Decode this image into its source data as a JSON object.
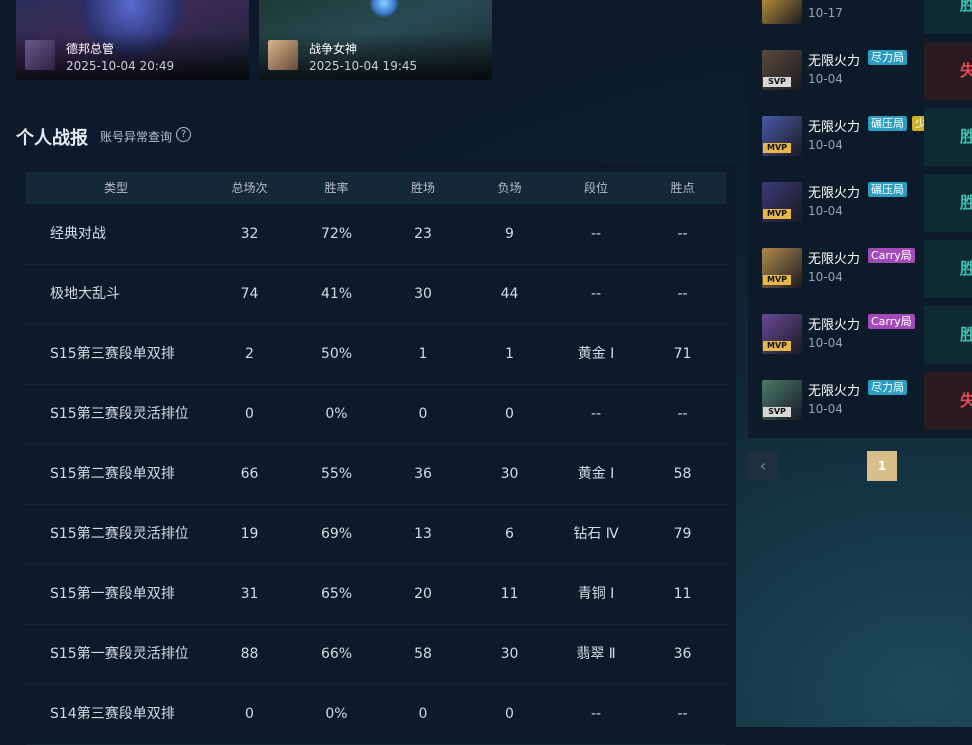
{
  "recent_games": [
    {
      "champion": "德邦总管",
      "time": "2025-10-04 20:49"
    },
    {
      "champion": "战争女神",
      "time": "2025-10-04 19:45"
    }
  ],
  "section": {
    "title": "个人战报",
    "link": "账号异常查询",
    "help": "?"
  },
  "table": {
    "headers": [
      "类型",
      "总场次",
      "胜率",
      "胜场",
      "负场",
      "段位",
      "胜点"
    ],
    "rows": [
      [
        "经典对战",
        "32",
        "72%",
        "23",
        "9",
        "--",
        "--"
      ],
      [
        "极地大乱斗",
        "74",
        "41%",
        "30",
        "44",
        "--",
        "--"
      ],
      [
        "S15第三赛段单双排",
        "2",
        "50%",
        "1",
        "1",
        "黄金 Ⅰ",
        "71"
      ],
      [
        "S15第三赛段灵活排位",
        "0",
        "0%",
        "0",
        "0",
        "--",
        "--"
      ],
      [
        "S15第二赛段单双排",
        "66",
        "55%",
        "36",
        "30",
        "黄金 Ⅰ",
        "58"
      ],
      [
        "S15第二赛段灵活排位",
        "19",
        "69%",
        "13",
        "6",
        "钻石 Ⅳ",
        "79"
      ],
      [
        "S15第一赛段单双排",
        "31",
        "65%",
        "20",
        "11",
        "青铜 Ⅰ",
        "11"
      ],
      [
        "S15第一赛段灵活排位",
        "88",
        "66%",
        "58",
        "30",
        "翡翠 Ⅱ",
        "36"
      ],
      [
        "S14第三赛段单双排",
        "0",
        "0%",
        "0",
        "0",
        "--",
        "--"
      ]
    ]
  },
  "match_records": [
    {
      "mode": "",
      "date": "10-17",
      "tags": [],
      "badge": "",
      "result": "胜",
      "outcome": "win",
      "color": "#d6a53c"
    },
    {
      "mode": "无限火力",
      "date": "10-04",
      "tags": [
        {
          "text": "尽力局",
          "style": "cyan"
        }
      ],
      "badge": "SVP",
      "result": "失",
      "outcome": "loss",
      "color": "#5a4a3a"
    },
    {
      "mode": "无限火力",
      "date": "10-04",
      "tags": [
        {
          "text": "碾压局",
          "style": "cyan"
        },
        {
          "text": "少胜多",
          "style": "yellow"
        }
      ],
      "badge": "MVP",
      "result": "胜",
      "outcome": "win",
      "color": "#4a5aa8"
    },
    {
      "mode": "无限火力",
      "date": "10-04",
      "tags": [
        {
          "text": "碾压局",
          "style": "cyan"
        }
      ],
      "badge": "MVP",
      "result": "胜",
      "outcome": "win",
      "color": "#3a3a78"
    },
    {
      "mode": "无限火力",
      "date": "10-04",
      "tags": [
        {
          "text": "Carry局",
          "style": "purple"
        }
      ],
      "badge": "MVP",
      "result": "胜",
      "outcome": "win",
      "color": "#b08a4a"
    },
    {
      "mode": "无限火力",
      "date": "10-04",
      "tags": [
        {
          "text": "Carry局",
          "style": "purple"
        }
      ],
      "badge": "MVP",
      "result": "胜",
      "outcome": "win",
      "color": "#6a4a9a"
    },
    {
      "mode": "无限火力",
      "date": "10-04",
      "tags": [
        {
          "text": "尽力局",
          "style": "cyan"
        }
      ],
      "badge": "SVP",
      "result": "失",
      "outcome": "loss",
      "color": "#4a7a6a"
    }
  ],
  "pagination": {
    "prev": "‹",
    "current": "1"
  }
}
